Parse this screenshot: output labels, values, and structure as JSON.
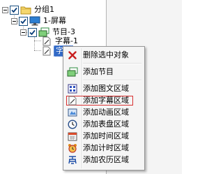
{
  "tree": {
    "nodes": [
      {
        "label": "分组1",
        "icon": "folder-icon",
        "checked": true
      },
      {
        "label": "1-屏幕",
        "icon": "monitor-icon",
        "checked": true
      },
      {
        "label": "节目-3",
        "icon": "program-icon",
        "checked": true
      },
      {
        "label": "字幕-1",
        "icon": "document-icon",
        "checked": false
      },
      {
        "label": "字幕",
        "icon": "document-icon",
        "checked": false,
        "selected": true
      }
    ]
  },
  "context_menu": {
    "items": [
      {
        "label": "删除选中对象",
        "icon": "delete-x-icon"
      },
      {
        "label": "添加节目",
        "icon": "program-icon"
      },
      {
        "label": "添加图文区域",
        "icon": "image-text-icon"
      },
      {
        "label": "添加字幕区域",
        "icon": "subtitle-icon",
        "highlighted": true
      },
      {
        "label": "添加动画区域",
        "icon": "animation-icon"
      },
      {
        "label": "添加表盘区域",
        "icon": "clock-dial-icon"
      },
      {
        "label": "添加时间区域",
        "icon": "calendar-icon"
      },
      {
        "label": "添加计时区域",
        "icon": "alarm-clock-icon"
      },
      {
        "label": "添加农历区域",
        "icon": "lunar-calendar-icon"
      }
    ]
  },
  "colors": {
    "selection": "#3169c6",
    "highlight_border": "#d83030",
    "menu_background": "#f5f5f5"
  }
}
